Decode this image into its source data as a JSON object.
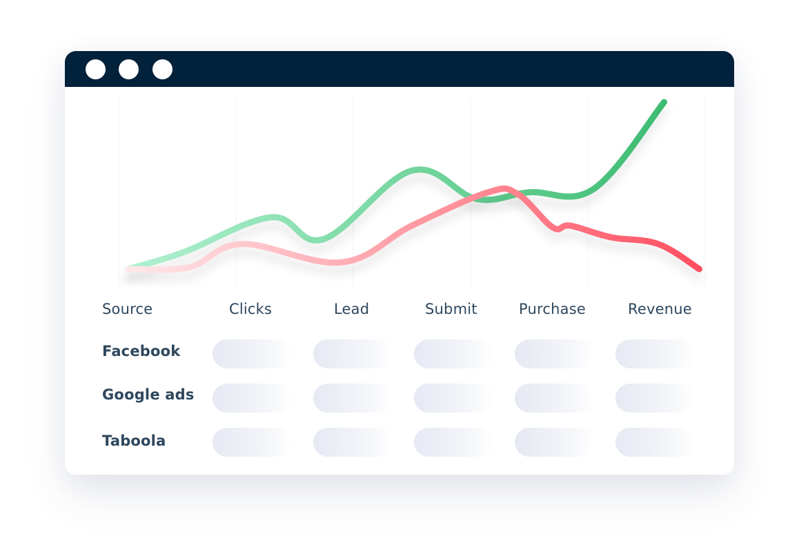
{
  "window": {
    "controls": [
      {
        "name": "window-dot-1",
        "color": "#ffffff"
      },
      {
        "name": "window-dot-2",
        "color": "#ffffff"
      },
      {
        "name": "window-dot-3",
        "color": "#ffffff"
      }
    ],
    "titlebar_color": "#02213b"
  },
  "table": {
    "headers": [
      "Source",
      "Clicks",
      "Lead",
      "Submit",
      "Purchase",
      "Revenue"
    ],
    "rows": [
      {
        "source": "Facebook"
      },
      {
        "source": "Google ads"
      },
      {
        "source": "Taboola"
      }
    ],
    "placeholder_cells_per_row": 5
  },
  "chart_data": {
    "type": "line",
    "title": "",
    "xlabel": "",
    "ylabel": "",
    "x": [
      0,
      0.5,
      1,
      1.5,
      2,
      2.5,
      3,
      3.5,
      4,
      4.5,
      5
    ],
    "grid": {
      "vertical": true,
      "horizontal": false,
      "vertical_lines": 6
    },
    "ylim": [
      0,
      100
    ],
    "series": [
      {
        "name": "green-trend",
        "color_start": "#b3f2d2",
        "color_end": "#34b86a",
        "points": [
          [
            0.08,
            0
          ],
          [
            0.55,
            10
          ],
          [
            1.3,
            31
          ],
          [
            1.75,
            18
          ],
          [
            2.5,
            59
          ],
          [
            3.05,
            42
          ],
          [
            3.5,
            46
          ],
          [
            4.05,
            48
          ],
          [
            4.65,
            100
          ]
        ]
      },
      {
        "name": "red-trend",
        "color_start": "#ffeaec",
        "color_end": "#ff4d5e",
        "points": [
          [
            0.08,
            0
          ],
          [
            0.6,
            1
          ],
          [
            1.05,
            15
          ],
          [
            1.9,
            4
          ],
          [
            2.5,
            26
          ],
          [
            3.15,
            46
          ],
          [
            3.4,
            45
          ],
          [
            3.7,
            25
          ],
          [
            3.85,
            26
          ],
          [
            4.2,
            19
          ],
          [
            4.6,
            15
          ],
          [
            4.95,
            0
          ]
        ]
      }
    ]
  }
}
